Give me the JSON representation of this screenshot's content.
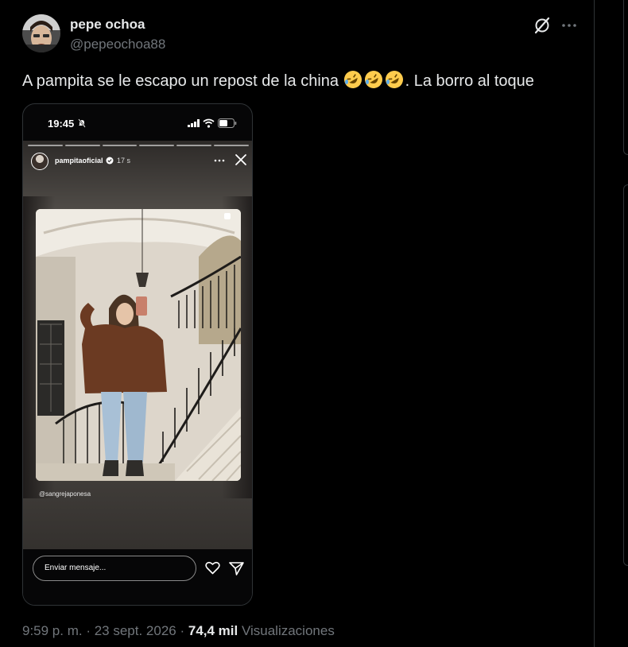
{
  "tweet": {
    "author": {
      "name": "pepe ochoa",
      "handle": "@pepeochoa88"
    },
    "text": "A pampita se le escapo un repost de la china",
    "text_after_emoji": ". La borro al toque",
    "emoji": [
      "rolling-on-floor-laughing",
      "rolling-on-floor-laughing",
      "rolling-on-floor-laughing"
    ],
    "meta": {
      "time": "9:59 p. m.",
      "sep1": " · ",
      "date": "23 sept. 2026",
      "sep2": " · ",
      "views_count": "74,4 mil",
      "views_label": " Visualizaciones"
    },
    "icons": {
      "grok": "grok-icon",
      "more": "more-icon"
    }
  },
  "media": {
    "phone_status": {
      "time": "19:45"
    },
    "story": {
      "username": "pampitaoficial",
      "time_ago": "17 s",
      "credit": "@sangrejaponesa",
      "progress_segments": 6
    },
    "reply": {
      "placeholder": "Enviar mensaje..."
    }
  },
  "colors": {
    "background": "#000000",
    "text": "#e7e9ea",
    "secondary": "#71767b",
    "border": "#2f3336"
  }
}
